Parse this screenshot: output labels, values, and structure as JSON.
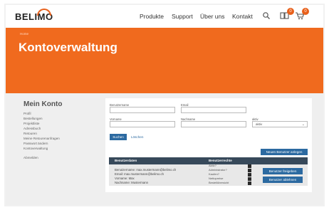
{
  "header": {
    "logo": "BELIMO",
    "nav": [
      "Produkte",
      "Support",
      "Über uns",
      "Kontakt"
    ],
    "compare_count": "0",
    "cart_count": "0"
  },
  "hero": {
    "breadcrumb": "Home",
    "title": "Kontoverwaltung"
  },
  "sidebar": {
    "title": "Mein Konto",
    "items": [
      "Profil",
      "Bestellungen",
      "Projektliste",
      "Adressbuch",
      "Retouren",
      "Meine Retourenanfragen",
      "Passwort ändern",
      "Kontoverwaltung"
    ],
    "logout": "Abmelden"
  },
  "search": {
    "username_label": "Benutzername",
    "email_label": "Email",
    "firstname_label": "Vorname",
    "lastname_label": "Nachname",
    "active_label": "aktiv",
    "active_value": "aktiv",
    "search_button": "Suchen",
    "clear_link": "Löschen",
    "new_user_button": "Neuen Benutzer anlegen"
  },
  "table": {
    "col_userdata": "Benutzerdaten",
    "col_rights": "Benutzerrechte",
    "row": {
      "username": "Benutzername: max.mustermann@belimo.ch",
      "email": "Email: max.mustermann@belimo.ch",
      "firstname": "Vorname: Max",
      "lastname": "Nachname: Mustermann",
      "rights": [
        "Aktiv?",
        "Administrator?",
        "Kaufen?",
        "Nettopreise",
        "Bestellübersicht"
      ],
      "approve_button": "Benutzer freigeben",
      "reject_button": "Benutzer ablehnen"
    }
  },
  "colors": {
    "brand_orange": "#f06a1e",
    "button_blue": "#2c6aa1",
    "table_header": "#37495a"
  }
}
